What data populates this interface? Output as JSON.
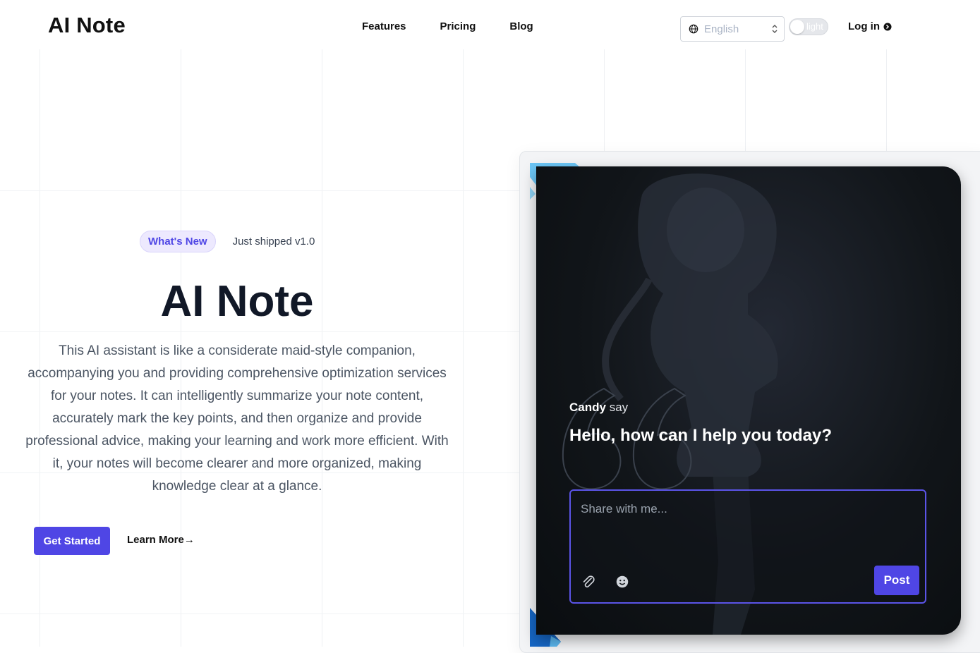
{
  "header": {
    "logo": "AI Note",
    "nav": [
      {
        "label": "Features"
      },
      {
        "label": "Pricing"
      },
      {
        "label": "Blog"
      }
    ],
    "language_select": {
      "value": "English",
      "icon": "globe-icon"
    },
    "theme_toggle": {
      "label": "light"
    },
    "login": {
      "label": "Log in",
      "icon": "arrow-right-circle-icon"
    }
  },
  "hero": {
    "badge": "What's New",
    "badge_note": "Just shipped v1.0",
    "title": "AI Note",
    "description": "This AI assistant is like a considerate maid-style companion, accompanying you and providing comprehensive optimization services for your notes. It can intelligently summarize your note content, accurately mark the key points, and then organize and provide professional advice, making your learning and work more efficient. With it, your notes will become clearer and more organized, making knowledge clear at a glance.",
    "primary_button": "Get Started",
    "secondary_link": "Learn More→"
  },
  "chat_card": {
    "speaker_name": "Candy",
    "speaker_verb": "say",
    "greeting": "Hello, how can I help you today?",
    "input_placeholder": "Share with me...",
    "post_button": "Post",
    "icons": [
      "paperclip-icon",
      "emoji-icon",
      "quote-icon"
    ]
  },
  "colors": {
    "accent": "#4f46e5",
    "badge_bg": "#ede9fe",
    "card_bg": "#111519",
    "deco_blue": "#5bc8f5"
  }
}
